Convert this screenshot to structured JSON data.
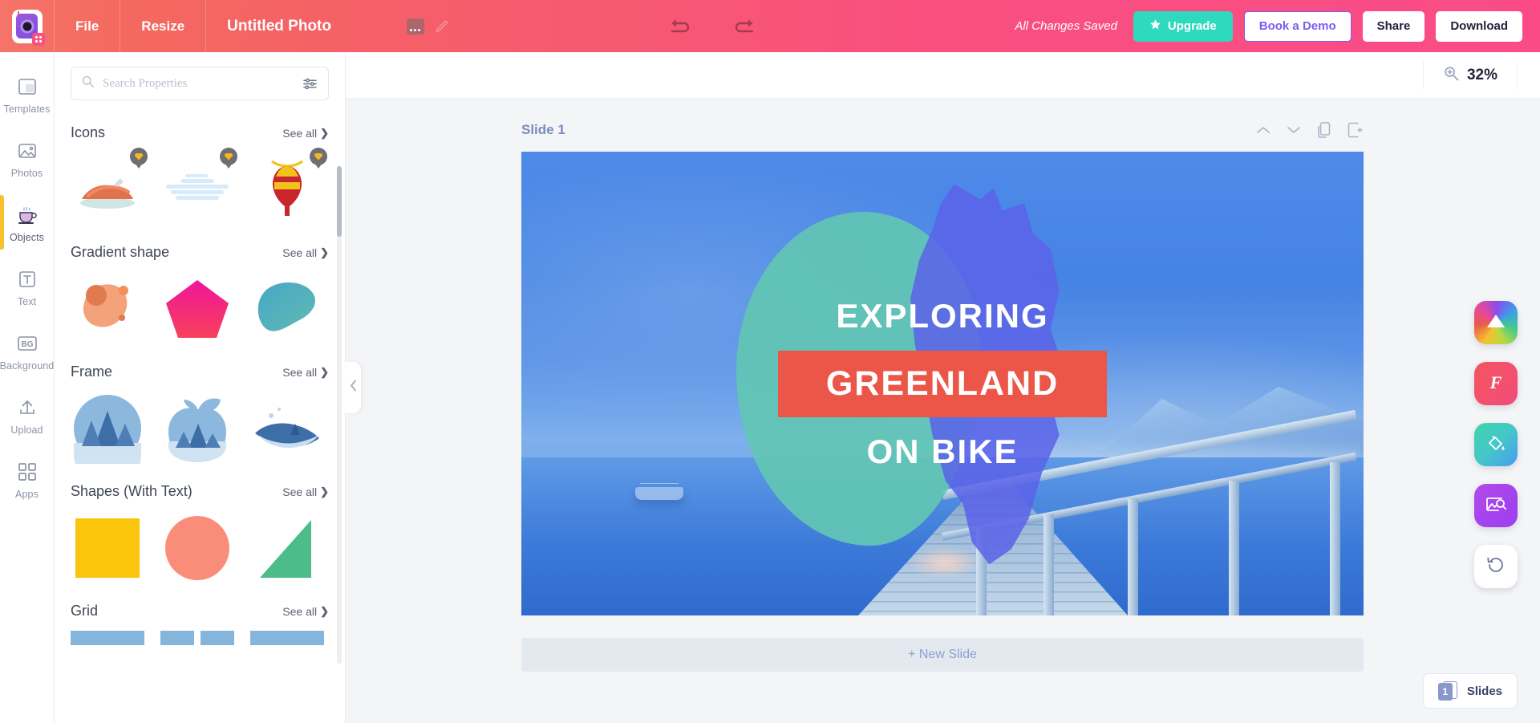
{
  "header": {
    "logo_icon": "camera-logo-icon",
    "menu": [
      {
        "label": "File",
        "name": "menu-file"
      },
      {
        "label": "Resize",
        "name": "menu-resize"
      }
    ],
    "document_title": "Untitled Photo",
    "title_more_icon": "more-dots-icon",
    "title_edit_icon": "pencil-icon",
    "undo_icon": "undo-arrow-icon",
    "redo_icon": "redo-arrow-icon",
    "saved_status": "All Changes Saved",
    "upgrade_label": "Upgrade",
    "upgrade_icon": "star-icon",
    "demo_label": "Book a Demo",
    "share_label": "Share",
    "download_label": "Download",
    "accent_coral": "#f4746a",
    "accent_pink": "#fa4b86",
    "accent_teal": "#2fd9bd",
    "accent_purple": "#7d5cf5"
  },
  "rail": {
    "items": [
      {
        "label": "Templates",
        "icon": "templates-icon",
        "active": false
      },
      {
        "label": "Photos",
        "icon": "photos-icon",
        "active": false
      },
      {
        "label": "Objects",
        "icon": "objects-cup-icon",
        "active": true
      },
      {
        "label": "Text",
        "icon": "text-icon",
        "active": false
      },
      {
        "label": "Background",
        "icon": "background-icon",
        "active": false
      },
      {
        "label": "Upload",
        "icon": "upload-icon",
        "active": false
      },
      {
        "label": "Apps",
        "icon": "apps-grid-icon",
        "active": false
      }
    ],
    "active_indicator_color": "#f7c22e"
  },
  "panel": {
    "search_placeholder": "Search Properties",
    "search_value": "",
    "search_icon": "search-icon",
    "filter_icon": "filter-sliders-icon",
    "see_all_label": "See all",
    "sections": [
      {
        "title": "Icons",
        "name": "section-icons"
      },
      {
        "title": "Gradient shape",
        "name": "section-gradient-shape"
      },
      {
        "title": "Frame",
        "name": "section-frame"
      },
      {
        "title": "Shapes (With Text)",
        "name": "section-shapes-with-text"
      },
      {
        "title": "Grid",
        "name": "section-grid"
      }
    ],
    "collapse_icon": "chevron-left-icon"
  },
  "canvas": {
    "zoom_icon": "zoom-in-icon",
    "zoom_level": "32%",
    "slide_label": "Slide 1",
    "slide_tools": [
      {
        "icon": "chevron-up-icon",
        "name": "move-slide-up-button"
      },
      {
        "icon": "chevron-down-icon",
        "name": "move-slide-down-button"
      },
      {
        "icon": "duplicate-slide-icon",
        "name": "duplicate-slide-button"
      },
      {
        "icon": "add-slide-icon",
        "name": "add-slide-button"
      }
    ],
    "design": {
      "line1": "EXPLORING",
      "line2": "GREENLAND",
      "line3": "ON BIKE",
      "highlight_color": "#eb5648",
      "blob_color": "#62c5b4",
      "map_color": "#5b63e8",
      "text_color": "#ffffff"
    },
    "new_slide_label": "+ New Slide"
  },
  "app_dock": [
    {
      "name": "effects-app-button",
      "icon": "rainbow-mountain-icon"
    },
    {
      "name": "fonts-app-button",
      "icon": "font-f-icon"
    },
    {
      "name": "fill-app-button",
      "icon": "paint-bucket-icon"
    },
    {
      "name": "image-search-app-button",
      "icon": "image-search-icon"
    },
    {
      "name": "history-button",
      "icon": "history-rotate-icon"
    }
  ],
  "slides_chip": {
    "count": "1",
    "label": "Slides"
  }
}
